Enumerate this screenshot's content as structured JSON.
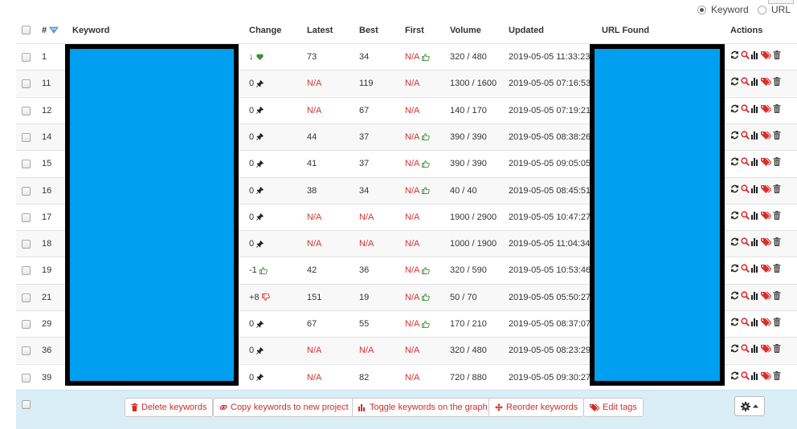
{
  "search_mode": {
    "options": [
      {
        "label": "Keyword",
        "selected": true
      },
      {
        "label": "URL",
        "selected": false
      }
    ]
  },
  "table": {
    "headers": {
      "select_all": "",
      "id": "#",
      "keyword": "Keyword",
      "change": "Change",
      "latest": "Latest",
      "best": "Best",
      "first": "First",
      "volume": "Volume",
      "updated": "Updated",
      "url_found": "URL Found",
      "actions": "Actions"
    },
    "rows": [
      {
        "id": "1",
        "change": "↓",
        "change_icon": "heart-icon",
        "latest": "73",
        "best": "34",
        "first": "N/A",
        "first_icon": "thumbs-up-icon",
        "volume": "320 / 480",
        "updated": "2019-05-05 11:33:23"
      },
      {
        "id": "11",
        "change": "0",
        "change_icon": "pin-icon",
        "latest": "N/A",
        "best": "119",
        "first": "N/A",
        "first_icon": "",
        "volume": "1300 / 1600",
        "updated": "2019-05-05 07:16:53"
      },
      {
        "id": "12",
        "change": "0",
        "change_icon": "pin-icon",
        "latest": "N/A",
        "best": "67",
        "first": "N/A",
        "first_icon": "",
        "volume": "140 / 170",
        "updated": "2019-05-05 07:19:21"
      },
      {
        "id": "14",
        "change": "0",
        "change_icon": "pin-icon",
        "latest": "44",
        "best": "37",
        "first": "N/A",
        "first_icon": "thumbs-up-icon",
        "volume": "390 / 390",
        "updated": "2019-05-05 08:38:26"
      },
      {
        "id": "15",
        "change": "0",
        "change_icon": "pin-icon",
        "latest": "41",
        "best": "37",
        "first": "N/A",
        "first_icon": "thumbs-up-icon",
        "volume": "390 / 390",
        "updated": "2019-05-05 09:05:05"
      },
      {
        "id": "16",
        "change": "0",
        "change_icon": "pin-icon",
        "latest": "38",
        "best": "34",
        "first": "N/A",
        "first_icon": "thumbs-up-icon",
        "volume": "40 / 40",
        "updated": "2019-05-05 08:45:51"
      },
      {
        "id": "17",
        "change": "0",
        "change_icon": "pin-icon",
        "latest": "N/A",
        "best": "N/A",
        "first": "N/A",
        "first_icon": "",
        "volume": "1900 / 2900",
        "updated": "2019-05-05 10:47:27"
      },
      {
        "id": "18",
        "change": "0",
        "change_icon": "pin-icon",
        "latest": "N/A",
        "best": "N/A",
        "first": "N/A",
        "first_icon": "",
        "volume": "1000 / 1900",
        "updated": "2019-05-05 11:04:34"
      },
      {
        "id": "19",
        "change": "-1",
        "change_icon": "thumbs-up-icon",
        "latest": "42",
        "best": "36",
        "first": "N/A",
        "first_icon": "thumbs-up-icon",
        "volume": "320 / 590",
        "updated": "2019-05-05 10:53:46"
      },
      {
        "id": "21",
        "change": "+8",
        "change_icon": "thumbs-down-icon",
        "latest": "151",
        "best": "19",
        "first": "N/A",
        "first_icon": "thumbs-up-icon",
        "volume": "50 / 70",
        "updated": "2019-05-05 05:50:27"
      },
      {
        "id": "29",
        "change": "0",
        "change_icon": "pin-icon",
        "latest": "67",
        "best": "55",
        "first": "N/A",
        "first_icon": "thumbs-up-icon",
        "volume": "170 / 210",
        "updated": "2019-05-05 08:37:07"
      },
      {
        "id": "36",
        "change": "0",
        "change_icon": "pin-icon",
        "latest": "N/A",
        "best": "N/A",
        "first": "N/A",
        "first_icon": "",
        "volume": "320 / 480",
        "updated": "2019-05-05 08:23:29"
      },
      {
        "id": "39",
        "change": "0",
        "change_icon": "pin-icon",
        "latest": "N/A",
        "best": "82",
        "first": "N/A",
        "first_icon": "",
        "volume": "720 / 880",
        "updated": "2019-05-05 09:30:27"
      }
    ],
    "row_actions": [
      "refresh-icon",
      "search-icon",
      "bar-chart-icon",
      "tag-icon",
      "trash-icon"
    ]
  },
  "footer": {
    "buttons": [
      {
        "label": "Delete keywords",
        "icon": "trash-icon"
      },
      {
        "label": "Copy keywords to new project",
        "icon": "link-icon"
      },
      {
        "label": "Toggle keywords on the graph",
        "icon": "bar-chart-icon"
      },
      {
        "label": "Reorder keywords",
        "icon": "move-icon"
      },
      {
        "label": "Edit tags",
        "icon": "tags-icon"
      }
    ],
    "settings_icon": "gear-icon"
  },
  "colors": {
    "na_text": "#d9302c",
    "positive": "#3a8f2e",
    "negative": "#d9302c",
    "redaction_fill": "#009ff0",
    "footer_bg": "#d9eef7"
  }
}
